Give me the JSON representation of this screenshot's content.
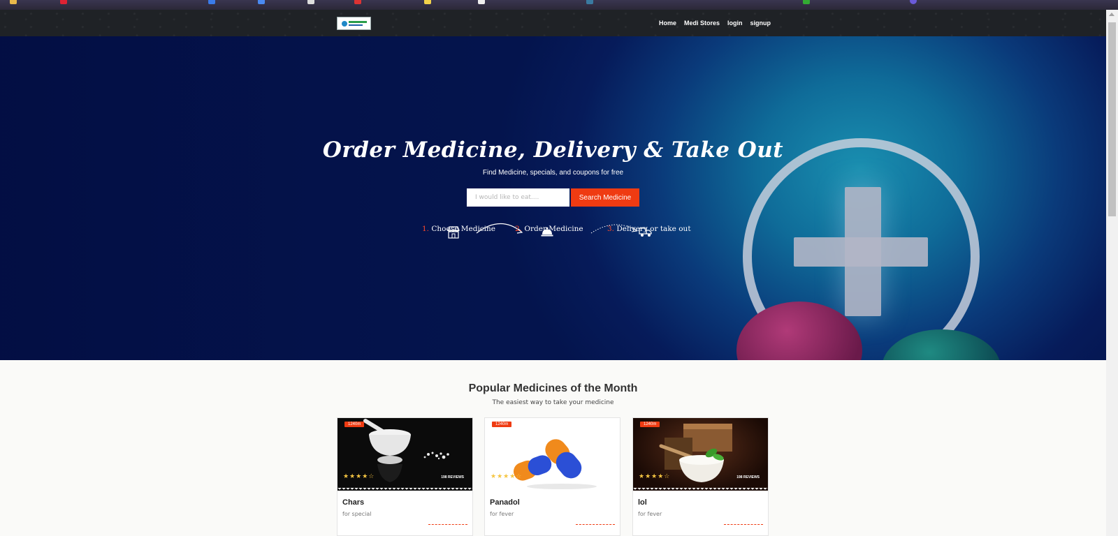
{
  "navbar": {
    "links": [
      "Home",
      "Medi Stores",
      "login",
      "signup"
    ]
  },
  "hero": {
    "title": "Order Medicine, Delivery & Take Out",
    "subtitle": "Find Medicine, specials, and coupons for free",
    "search_placeholder": "I would like to eat....",
    "search_button": "Search Medicine",
    "steps": [
      {
        "num": "1.",
        "label": "Choose Medicine",
        "icon": "store-icon"
      },
      {
        "num": "2.",
        "label": "Order Medicine",
        "icon": "service-bell-icon"
      },
      {
        "num": "3.",
        "label": "Delivery or take out",
        "icon": "delivery-truck-icon"
      }
    ]
  },
  "popular": {
    "title": "Popular Medicines of the Month",
    "subtitle": "The easiest way to take your medicine",
    "cards": [
      {
        "badge": "1240m",
        "stars": "★★★★☆",
        "reviews": "198 REVIEWS",
        "name": "Chars",
        "desc": "for special",
        "image": "mortar-pestle-image"
      },
      {
        "badge": "1240m",
        "stars": "★★★★☆",
        "reviews": "",
        "name": "Panadol",
        "desc": "for fever",
        "image": "capsules-image"
      },
      {
        "badge": "1240m",
        "stars": "★★★★☆",
        "reviews": "198 REVIEWS",
        "name": "lol",
        "desc": "for fever",
        "image": "herbal-mortar-image"
      }
    ]
  },
  "colors": {
    "accent": "#ef3b12",
    "navbar": "#1f2226",
    "hero_dark": "#04144d",
    "hero_glow": "#1a8fb0"
  }
}
